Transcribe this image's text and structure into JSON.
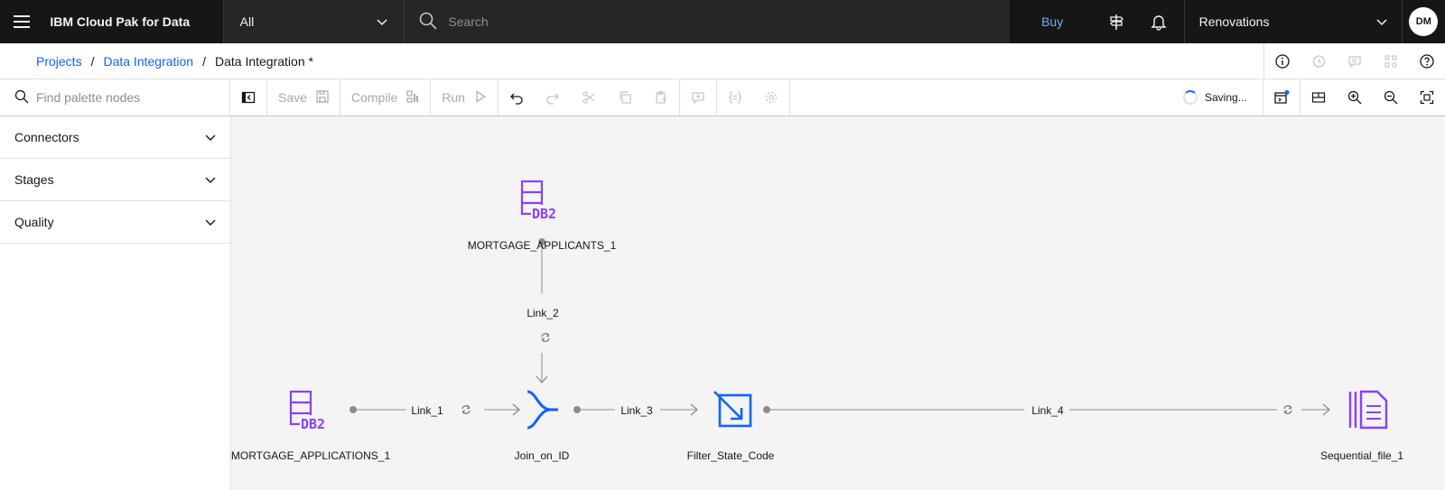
{
  "header": {
    "menu_icon": "hamburger-menu-icon",
    "brand": "IBM Cloud Pak for Data",
    "scope": "All",
    "search_placeholder": "Search",
    "buy": "Buy",
    "project": "Renovations",
    "avatar_initials": "DM",
    "icons": [
      "signpost-icon",
      "notification-bell-icon"
    ]
  },
  "breadcrumb": {
    "items": [
      "Projects",
      "Data Integration"
    ],
    "current": "Data Integration *"
  },
  "toolbar": {
    "palette_search_placeholder": "Find palette nodes",
    "save": "Save",
    "compile": "Compile",
    "run": "Run",
    "status": "Saving..."
  },
  "palette": {
    "sections": [
      "Connectors",
      "Stages",
      "Quality"
    ]
  },
  "flow": {
    "nodes": [
      {
        "id": "n1",
        "label": "MORTGAGE_APPLICANTS_1",
        "type": "db2"
      },
      {
        "id": "n2",
        "label": "MORTGAGE_APPLICATIONS_1",
        "type": "db2"
      },
      {
        "id": "n3",
        "label": "Join_on_ID",
        "type": "join"
      },
      {
        "id": "n4",
        "label": "Filter_State_Code",
        "type": "filter"
      },
      {
        "id": "n5",
        "label": "Sequential_file_1",
        "type": "file"
      }
    ],
    "links": [
      "Link_1",
      "Link_2",
      "Link_3",
      "Link_4"
    ]
  },
  "colors": {
    "header_bg": "#161616",
    "link_blue": "#0f62fe",
    "db2_purple": "#8a3ffc",
    "stage_blue": "#0f62fe",
    "canvas_bg": "#f4f4f4"
  }
}
